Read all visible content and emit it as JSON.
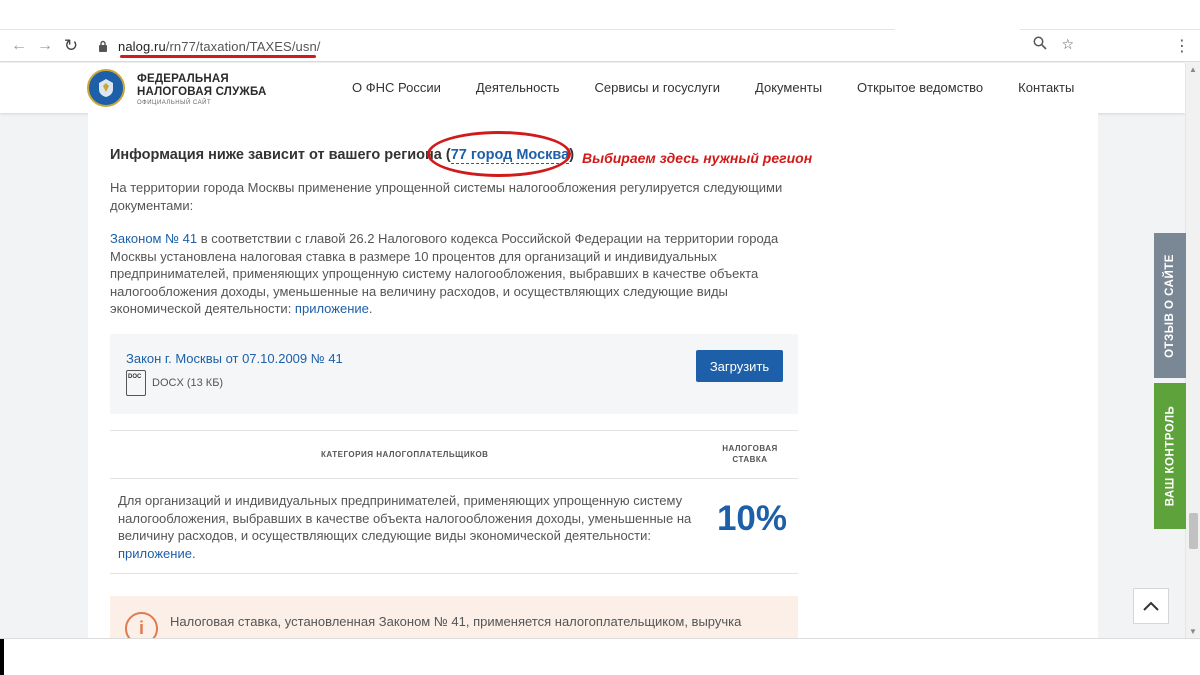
{
  "browser": {
    "url_host": "nalog.ru",
    "url_path": "/rn77/taxation/TAXES/usn/"
  },
  "header": {
    "logo_line1": "ФЕДЕРАЛЬНАЯ",
    "logo_line2": "НАЛОГОВАЯ СЛУЖБА",
    "logo_line3": "ОФИЦИАЛЬНЫЙ САЙТ",
    "nav": [
      {
        "label": "О ФНС России"
      },
      {
        "label": "Деятельность"
      },
      {
        "label": "Сервисы и госуслуги"
      },
      {
        "label": "Документы"
      },
      {
        "label": "Открытое ведомство"
      },
      {
        "label": "Контакты"
      }
    ]
  },
  "region": {
    "prefix": "Информация ниже зависит от вашего региона ",
    "open_paren": "(",
    "link": "77 город Москва",
    "close_paren": ")",
    "annotation": "Выбираем здесь нужный регион"
  },
  "paragraphs": {
    "intro": "На территории города Москвы применение упрощенной системы налогообложения регулируется следующими документами:",
    "law_link": "Законом № 41",
    "law_text": " в соответствии с главой 26.2 Налогового кодекса Российской Федерации на территории города Москвы установлена налоговая ставка в размере 10 процентов для организаций и индивидуальных предпринимателей, применяющих упрощенную систему налогообложения, выбравших в качестве объекта налогообложения доходы, уменьшенные на величину расходов, и осуществляющих следующие виды экономической деятельности: ",
    "appendix_link": "приложение",
    "end": "."
  },
  "document": {
    "title": "Закон г. Москвы от 07.10.2009 № 41",
    "icon_label": "DOC",
    "file_info": "DOCX (13 КБ)",
    "upload_label": "Загрузить"
  },
  "table": {
    "header_category": "КАТЕГОРИЯ НАЛОГОПЛАТЕЛЬЩИКОВ",
    "header_rate_line1": "НАЛОГОВАЯ",
    "header_rate_line2": "СТАВКА",
    "row_text": "Для организаций и индивидуальных предпринимателей, применяющих упрощенную систему налогообложения, выбравших в качестве объекта налогообложения доходы, уменьшенные на величину расходов, и осуществляющих следующие виды экономической деятельности: ",
    "row_link": "приложение",
    "row_end": ".",
    "row_rate": "10%"
  },
  "info": {
    "icon": "i",
    "text": "Налоговая ставка, установленная Законом № 41, применяется налогоплательщиком, выручка"
  },
  "side_tabs": {
    "feedback": "ОТЗЫВ О САЙТЕ",
    "control": "ВАШ КОНТРОЛЬ"
  },
  "colors": {
    "brand_blue": "#1d5fa8",
    "annotation_red": "#d11a1a",
    "feedback_tab": "#7a8794",
    "control_tab": "#5da23a"
  }
}
